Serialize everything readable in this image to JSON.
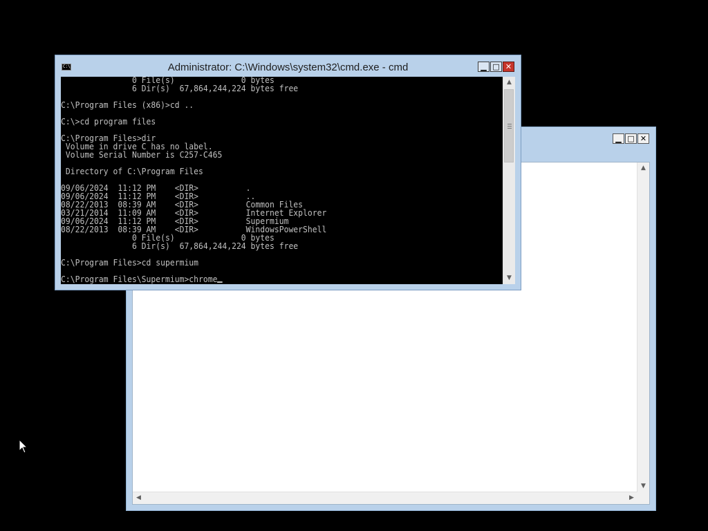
{
  "cmd_window": {
    "title": "Administrator: C:\\Windows\\system32\\cmd.exe - cmd",
    "icon_label": "C:\\",
    "console_lines": [
      "               0 File(s)              0 bytes",
      "               6 Dir(s)  67,864,244,224 bytes free",
      "",
      "C:\\Program Files (x86)>cd ..",
      "",
      "C:\\>cd program files",
      "",
      "C:\\Program Files>dir",
      " Volume in drive C has no label.",
      " Volume Serial Number is C257-C465",
      "",
      " Directory of C:\\Program Files",
      "",
      "09/06/2024  11:12 PM    <DIR>          .",
      "09/06/2024  11:12 PM    <DIR>          ..",
      "08/22/2013  08:39 AM    <DIR>          Common Files",
      "03/21/2014  11:09 AM    <DIR>          Internet Explorer",
      "09/06/2024  11:12 PM    <DIR>          Supermium",
      "08/22/2013  08:39 AM    <DIR>          WindowsPowerShell",
      "               0 File(s)              0 bytes",
      "               6 Dir(s)  67,864,244,224 bytes free",
      "",
      "C:\\Program Files>cd supermium",
      "",
      "C:\\Program Files\\Supermium>chrome"
    ],
    "controls": {
      "minimize": "▁",
      "maximize": "□",
      "close": "✕"
    }
  },
  "background_window": {
    "controls": {
      "minimize": "▁",
      "maximize": "□",
      "close": "✕"
    }
  },
  "icons": {
    "scroll_up": "▲",
    "scroll_down": "▼",
    "scroll_left": "◀",
    "scroll_right": "▶"
  },
  "colors": {
    "frame": "#b9d1ea",
    "close_button": "#c7352b",
    "console_bg": "#000000",
    "console_fg": "#c0c0c0"
  }
}
